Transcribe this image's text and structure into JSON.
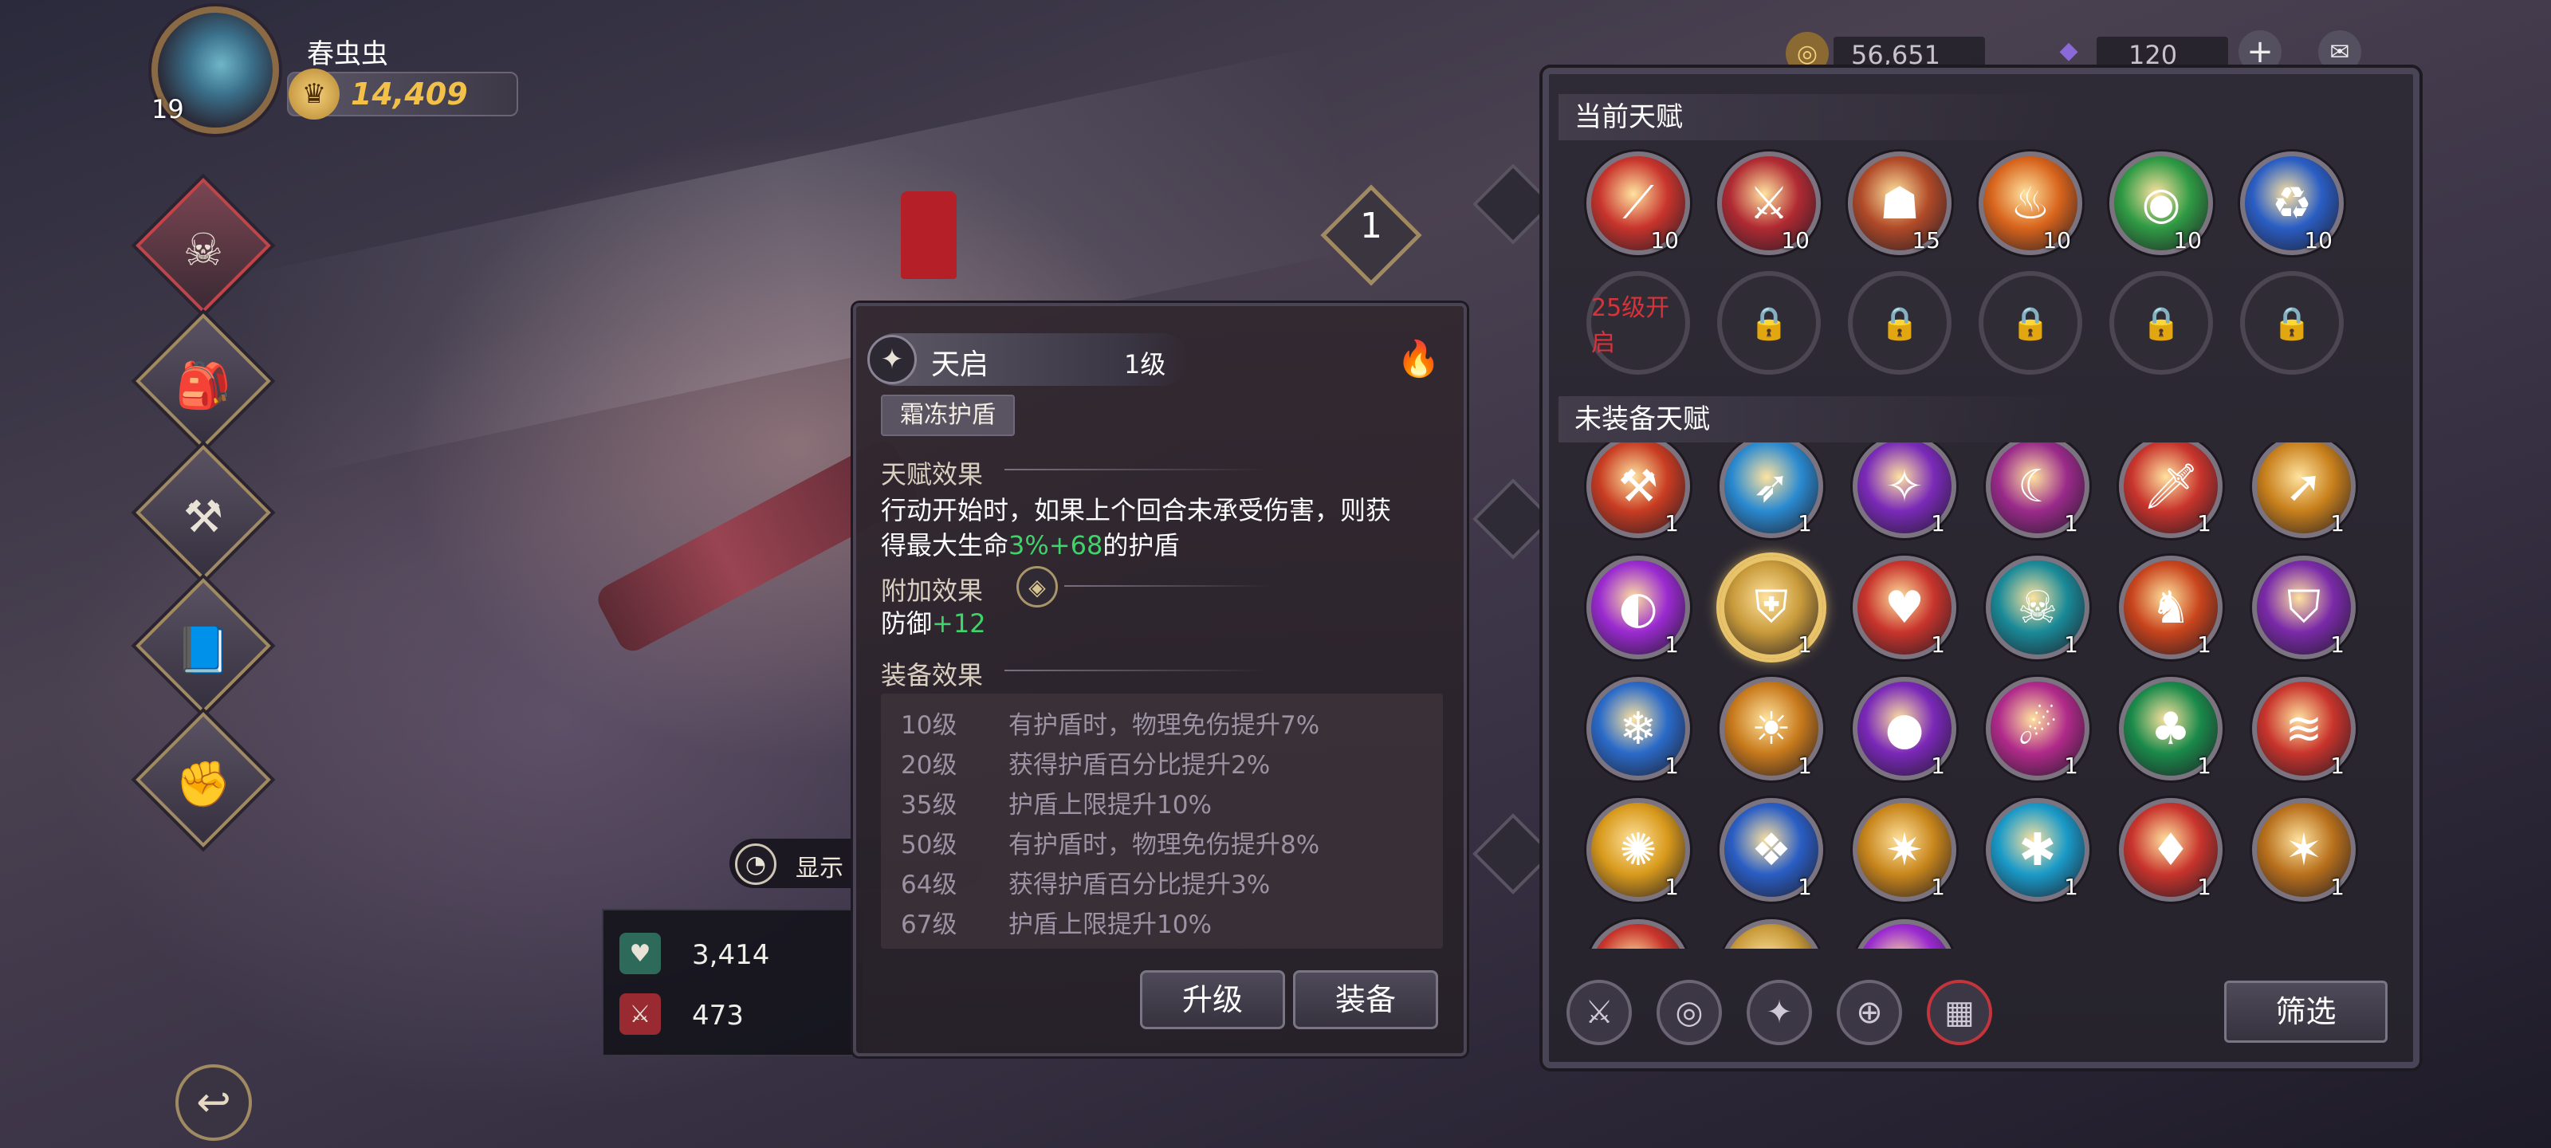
{
  "player": {
    "name": "春虫虫",
    "level": "19",
    "power": "14,409"
  },
  "currencies": {
    "gold": "56,651",
    "gems": "120"
  },
  "left_menu": [
    "hero-icon",
    "bag-icon",
    "weapon-icon",
    "book-icon",
    "upgrade-icon"
  ],
  "hero": {
    "badge_level": "1",
    "show_toggle_label": "显示",
    "stats": [
      {
        "icon": "hp-icon",
        "value": "3,414"
      },
      {
        "icon": "attack-icon",
        "value": "473"
      }
    ]
  },
  "talent_card": {
    "name": "天启",
    "level": "1级",
    "tag": "霜冻护盾",
    "talent_effect_title": "天赋效果",
    "talent_effect_line1": "行动开始时，如果上个回合未承受伤害，则获",
    "talent_effect_line2_pre": "得最大生命",
    "talent_effect_value": "3%+68",
    "talent_effect_line2_post": "的护盾",
    "bonus_title": "附加效果",
    "bonus_label": "防御",
    "bonus_value": "+12",
    "equip_title": "装备效果",
    "equip_rows": [
      {
        "level": "10级",
        "text": "有护盾时，物理免伤提升7%"
      },
      {
        "level": "20级",
        "text": "获得护盾百分比提升2%"
      },
      {
        "level": "35级",
        "text": "护盾上限提升10%"
      },
      {
        "level": "50级",
        "text": "有护盾时，物理免伤提升8%"
      },
      {
        "level": "64级",
        "text": "获得护盾百分比提升3%"
      },
      {
        "level": "67级",
        "text": "护盾上限提升10%"
      }
    ],
    "upgrade_button": "升级",
    "equip_button": "装备"
  },
  "panel": {
    "current_title": "当前天赋",
    "current_slots": [
      {
        "icon": "claw-slash-icon",
        "count": "10",
        "color": "#c8342c"
      },
      {
        "icon": "sword-warrior-icon",
        "count": "10",
        "color": "#b02a32"
      },
      {
        "icon": "golem-icon",
        "count": "15",
        "color": "#b04a28"
      },
      {
        "icon": "fire-demon-icon",
        "count": "10",
        "color": "#d8641c"
      },
      {
        "icon": "green-vortex-icon",
        "count": "10",
        "color": "#2f9a44"
      },
      {
        "icon": "blue-cycle-icon",
        "count": "10",
        "color": "#2a5ec4"
      }
    ],
    "locked_first_label": "25级开启",
    "unequipped_title": "未装备天赋",
    "unequipped": [
      {
        "icon": "fire-axe-icon",
        "count": "1",
        "color": "#c83c22"
      },
      {
        "icon": "ice-spear-icon",
        "count": "1",
        "color": "#2a8ad0"
      },
      {
        "icon": "purple-blade-icon",
        "count": "1",
        "color": "#7a2ab8"
      },
      {
        "icon": "shadow-ninja-icon",
        "count": "1",
        "color": "#9a2a8a"
      },
      {
        "icon": "fire-sword-icon",
        "count": "1",
        "color": "#c8342c"
      },
      {
        "icon": "golden-spear-icon",
        "count": "1",
        "color": "#c8801c"
      },
      {
        "icon": "purple-wave-icon",
        "count": "1",
        "color": "#9a2ad0"
      },
      {
        "icon": "golden-shield-icon",
        "count": "1",
        "color": "#c89a3a"
      },
      {
        "icon": "heal-heart-icon",
        "count": "1",
        "color": "#c8342c"
      },
      {
        "icon": "cyan-demon-icon",
        "count": "1",
        "color": "#1a8a98"
      },
      {
        "icon": "fire-beast-icon",
        "count": "1",
        "color": "#c8441c"
      },
      {
        "icon": "purple-armor-icon",
        "count": "1",
        "color": "#7a2aa8"
      },
      {
        "icon": "ice-mage-icon",
        "count": "1",
        "color": "#2a6ac8"
      },
      {
        "icon": "flame-imp-icon",
        "count": "1",
        "color": "#c87a1c"
      },
      {
        "icon": "dark-orb-icon",
        "count": "1",
        "color": "#7a28b8"
      },
      {
        "icon": "pink-ghost-icon",
        "count": "1",
        "color": "#b02a8a"
      },
      {
        "icon": "forest-spirit-icon",
        "count": "1",
        "color": "#1a8a4a"
      },
      {
        "icon": "red-claw-icon",
        "count": "1",
        "color": "#c8342c"
      },
      {
        "icon": "sun-burst-icon",
        "count": "1",
        "color": "#d89a1c"
      },
      {
        "icon": "blue-wings-icon",
        "count": "1",
        "color": "#2a5ec4"
      },
      {
        "icon": "golden-strike-icon",
        "count": "1",
        "color": "#c8861c"
      },
      {
        "icon": "ice-shard-icon",
        "count": "1",
        "color": "#1a9ac8"
      },
      {
        "icon": "red-flame-icon",
        "count": "1",
        "color": "#c8342c"
      },
      {
        "icon": "amber-shadow-icon",
        "count": "1",
        "color": "#b8701c"
      }
    ],
    "toolbar_icons": [
      "sword-filter-icon",
      "swirl-filter-icon",
      "sparkle-filter-icon",
      "target-filter-icon",
      "grid-filter-icon"
    ],
    "filter_button": "筛选"
  }
}
